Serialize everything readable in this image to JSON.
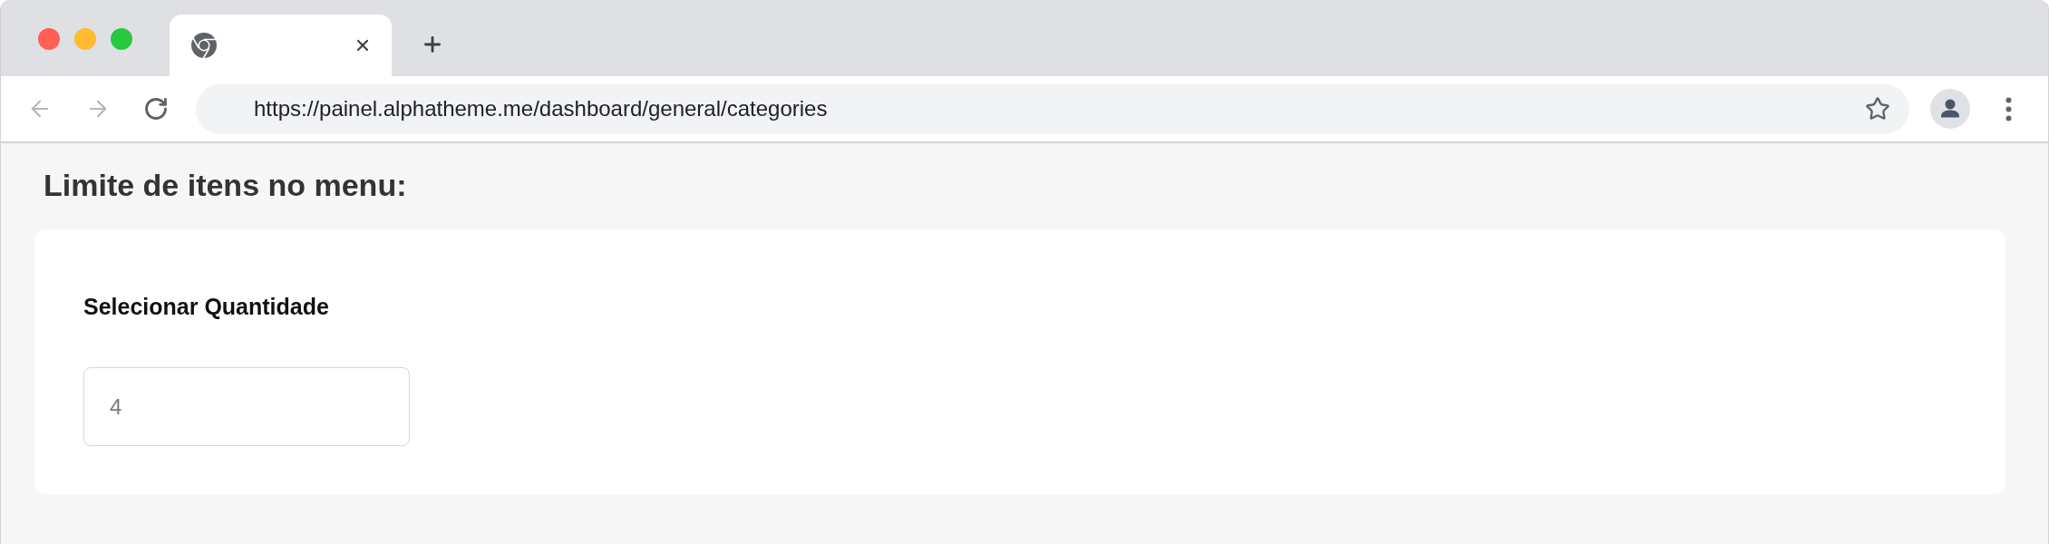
{
  "window_controls": [
    {
      "kind": "close"
    },
    {
      "kind": "minimize"
    },
    {
      "kind": "maximize"
    }
  ],
  "tabs": [
    {
      "selected": true
    }
  ],
  "toolbar": {
    "back": {
      "disabled": true
    },
    "forward": {
      "disabled": true
    },
    "url": "https://painel.alphatheme.me/dashboard/general/categories"
  },
  "page": {
    "heading": "Limite de itens no menu:",
    "card": {
      "label": "Selecionar Quantidade",
      "quantity_field": {
        "value": "4"
      }
    }
  }
}
